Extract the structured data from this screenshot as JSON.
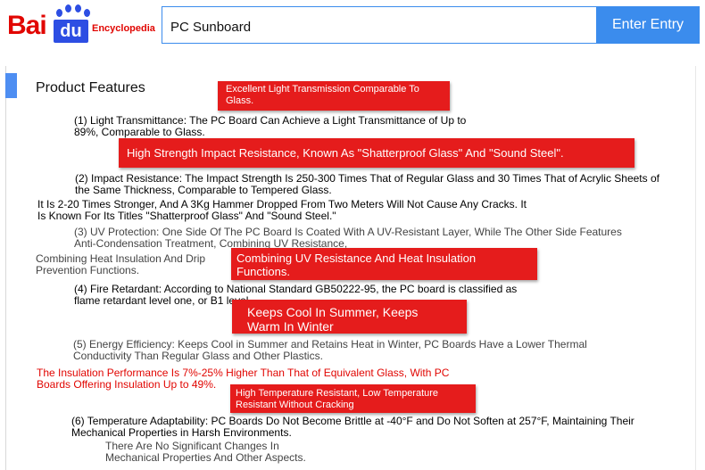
{
  "header": {
    "logo_bai": "Bai",
    "logo_du": "du",
    "logo_text": "Encyclopedia",
    "search_value": "PC Sunboard",
    "enter_button": "Enter Entry"
  },
  "section": {
    "title": "Product Features"
  },
  "paragraphs": {
    "light": "(1) Light Transmittance: The PC Board Can Achieve a Light Transmittance of Up to 89%, Comparable to Glass.",
    "impact": "(2) Impact Resistance: The Impact Strength Is 250-300 Times That of Regular Glass and 30 Times That of Acrylic Sheets of the Same Thickness, Comparable to Tempered Glass.",
    "impact_note": "It Is 2-20 Times Stronger, And A 3Kg Hammer Dropped From Two Meters Will Not Cause Any Cracks. It Is Known For Its Titles \"Shatterproof Glass\" And \"Sound Steel.\"",
    "uv": "(3) UV Protection: One Side Of The PC Board Is Coated With A UV-Resistant Layer, While The Other Side Features Anti-Condensation Treatment, Combining UV Resistance,",
    "uv_note": "Combining Heat Insulation And Drip Prevention Functions.",
    "fire": "(4) Fire Retardant: According to National Standard GB50222-95, the PC board is classified as flame retardant level one, or B1 level.",
    "energy": "(5) Energy Efficiency: Keeps Cool in Summer and Retains Heat in Winter, PC Boards Have a Lower Thermal Conductivity Than Regular Glass and Other Plastics.",
    "energy_note": "The Insulation Performance Is 7%-25% Higher Than That of Equivalent Glass, With PC Boards Offering Insulation Up to 49%.",
    "temp": "(6) Temperature Adaptability: PC Boards Do Not Become Brittle at -40°F and Do Not Soften at 257°F, Maintaining Their Mechanical Properties in Harsh Environments.",
    "temp_note": "There Are No Significant Changes In Mechanical Properties And Other Aspects."
  },
  "callouts": {
    "light": "Excellent Light Transmission Comparable To Glass.",
    "impact": "High Strength Impact Resistance, Known As \"Shatterproof Glass\" And \"Sound Steel\".",
    "uv": "Combining UV Resistance And Heat Insulation Functions.",
    "cool": "Keeps Cool In Summer, Keeps Warm In Winter",
    "temp": "High Temperature Resistant, Low Temperature Resistant Without Cracking"
  },
  "colors": {
    "brand_red": "#e10602",
    "brand_blue": "#2d4ee3",
    "button_blue": "#3b8ced",
    "callout_red": "#e51c1c",
    "section_bar": "#4e8ef2"
  }
}
